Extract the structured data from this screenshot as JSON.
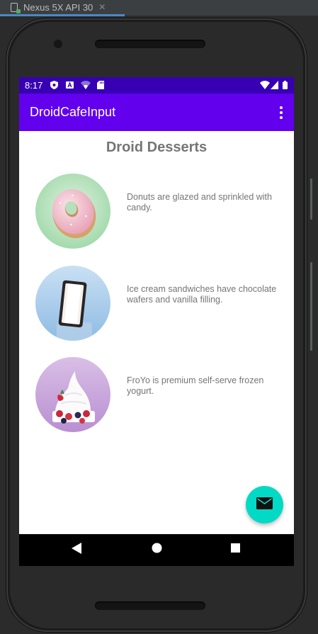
{
  "ide": {
    "tab_label": "Nexus 5X API 30",
    "close_glyph": "✕"
  },
  "status_bar": {
    "time": "8:17",
    "icons_left": [
      "shield-icon",
      "a-icon",
      "wifi-off-icon",
      "sd-card-icon"
    ],
    "icons_right": [
      "wifi-icon",
      "signal-icon",
      "battery-icon"
    ]
  },
  "app_bar": {
    "title": "DroidCafeInput",
    "menu_icon": "overflow-menu-icon"
  },
  "main": {
    "heading": "Droid Desserts",
    "items": [
      {
        "name": "donut",
        "description": "Donuts are glazed and sprinkled with candy."
      },
      {
        "name": "ice-cream-sandwich",
        "description": "Ice cream sandwiches have chocolate wafers and vanilla filling."
      },
      {
        "name": "froyo",
        "description": "FroYo is premium self-serve frozen yogurt."
      }
    ]
  },
  "fab": {
    "icon": "mail-icon"
  },
  "nav_bar": {
    "buttons": [
      "back-icon",
      "home-icon",
      "recents-icon"
    ]
  },
  "colors": {
    "status_bar": "#3700b3",
    "app_bar": "#6200ee",
    "fab": "#03dac5",
    "text_secondary": "#757575"
  }
}
